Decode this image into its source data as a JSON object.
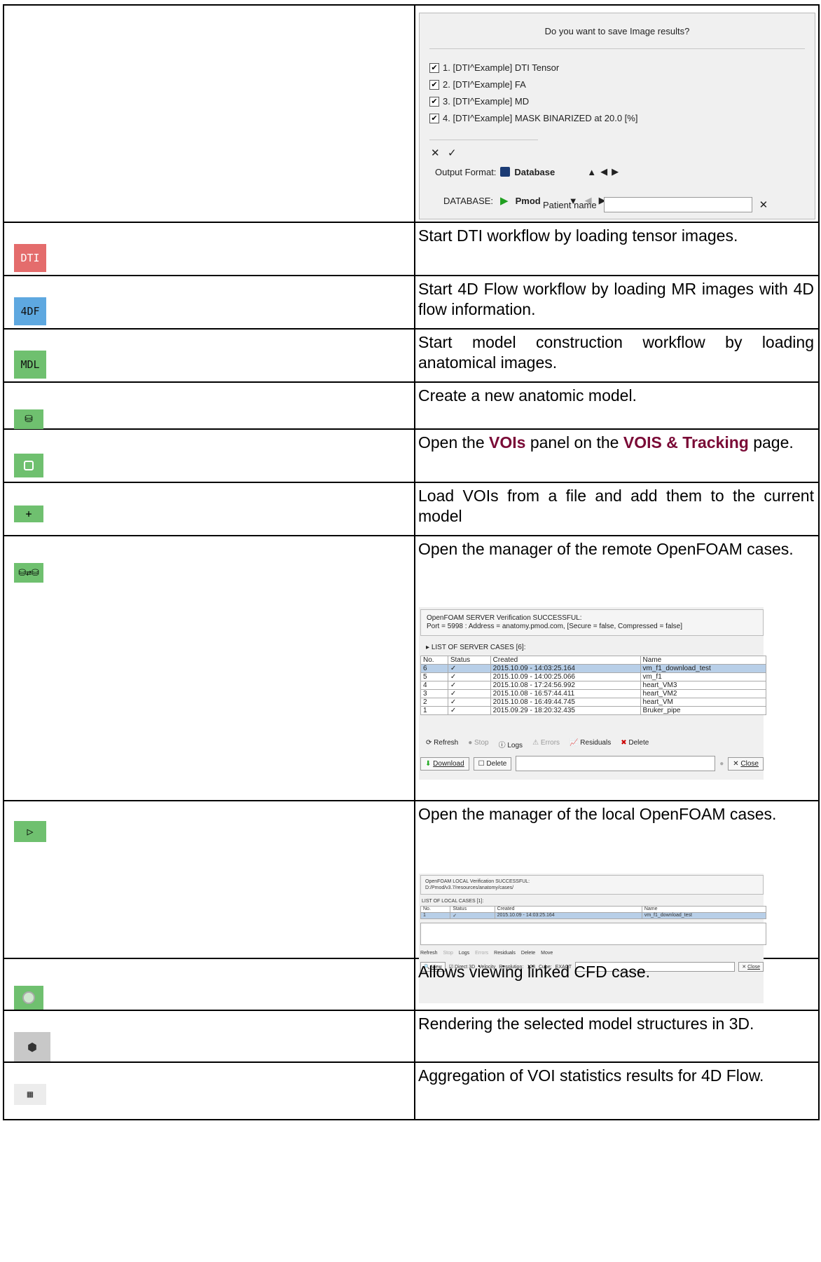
{
  "save_dialog": {
    "question": "Do you want to save Image results?",
    "items": [
      "1. [DTI^Example] DTI Tensor",
      "2. [DTI^Example] FA",
      "3. [DTI^Example] MD",
      "4. [DTI^Example] MASK BINARIZED at 20.0 [%]"
    ],
    "clear_symbol": "✕",
    "check_symbol": "✓",
    "output_format_label": "Output Format:",
    "output_format_value": "Database",
    "database_label": "DATABASE:",
    "database_value": "Pmod",
    "patient_label": "Patient name",
    "patient_value": ""
  },
  "rows": [
    {
      "icon_text": "DTI",
      "icon_color": "#e46c6c",
      "desc": "Start DTI workflow by loading tensor images."
    },
    {
      "icon_text": "4DF",
      "icon_color": "#5ea8e0",
      "desc": "Start 4D Flow workflow by loading MR images with 4D flow information."
    },
    {
      "icon_text": "MDL",
      "icon_color": "#6fc06f",
      "desc": "Start model construction workflow by loading anatomical images."
    },
    {
      "icon_text": "",
      "icon_color": "#6fc06f",
      "desc": "Create a new anatomic model."
    },
    {
      "icon_text": "",
      "icon_color": "#6fc06f",
      "desc_pre": "Open the ",
      "desc_b1": "VOIs",
      "desc_mid": " panel on the ",
      "desc_b2": "VOIS & Tracking",
      "desc_post": " page."
    },
    {
      "icon_text": "+",
      "icon_color": "#6fc06f",
      "desc": "Load VOIs from a file and add them to the current model"
    },
    {
      "icon_text": "",
      "icon_color": "#6fc06f",
      "desc": "Open the manager of the remote OpenFOAM cases."
    },
    {
      "icon_text": "▷",
      "icon_color": "#6fc06f",
      "desc": "Open the manager of the local OpenFOAM cases."
    },
    {
      "icon_text": "",
      "icon_color": "#6fc06f",
      "desc": "Allows viewing linked CFD case."
    },
    {
      "icon_text": "",
      "icon_color": "#c8c8c8",
      "desc": "Rendering the selected model structures in 3D."
    },
    {
      "icon_text": "",
      "icon_color": "#ececec",
      "desc": "Aggregation of VOI statistics results for 4D Flow."
    }
  ],
  "remote": {
    "status_line1": "OpenFOAM SERVER Verification SUCCESSFUL:",
    "status_line2": "Port = 5998 : Address = anatomy.pmod.com, [Secure = false, Compressed = false]",
    "list_title": "LIST OF SERVER CASES [6]:",
    "columns": [
      "No.",
      "Status",
      "Created",
      "Name"
    ],
    "cases": [
      [
        "6",
        "✓",
        "2015.10.09 - 14:03:25.164",
        "vm_f1_download_test"
      ],
      [
        "5",
        "✓",
        "2015.10.09 - 14:00:25.066",
        "vm_f1"
      ],
      [
        "4",
        "✓",
        "2015.10.08 - 17:24:56.992",
        "heart_VM3"
      ],
      [
        "3",
        "✓",
        "2015.10.08 - 16:57:44.411",
        "heart_VM2"
      ],
      [
        "2",
        "✓",
        "2015.10.08 - 16:49:44.745",
        "heart_VM"
      ],
      [
        "1",
        "✓",
        "2015.09.29 - 18:20:32.435",
        "Bruker_pipe"
      ]
    ],
    "actions": [
      "Refresh",
      "Stop",
      "Logs",
      "Errors",
      "Residuals",
      "Delete"
    ],
    "download": "Download",
    "delete_chk": "Delete",
    "close": "Close"
  },
  "local": {
    "status_line1": "OpenFOAM LOCAL Verification SUCCESSFUL:",
    "status_line2": "D:/Pmod/v3.7/resources/anatomy/cases/",
    "list_title": "LIST OF LOCAL CASES [1]:",
    "columns": [
      "No.",
      "Status",
      "Created",
      "Name"
    ],
    "case": [
      "1",
      "✓",
      "2015.10.09 - 14:03:25.164",
      "vm_f1_download_test"
    ],
    "actions": [
      "Refresh",
      "Stop",
      "Logs",
      "Errors",
      "Residuals",
      "Delete",
      "Move"
    ],
    "view": "View",
    "direct3d": "Direct 3D",
    "velocity": "Velocity",
    "resolution_label": "Resolution:",
    "resolution_value": "128",
    "cube_label": "Cube:",
    "cube_value": "EXACT",
    "close": "Close"
  }
}
